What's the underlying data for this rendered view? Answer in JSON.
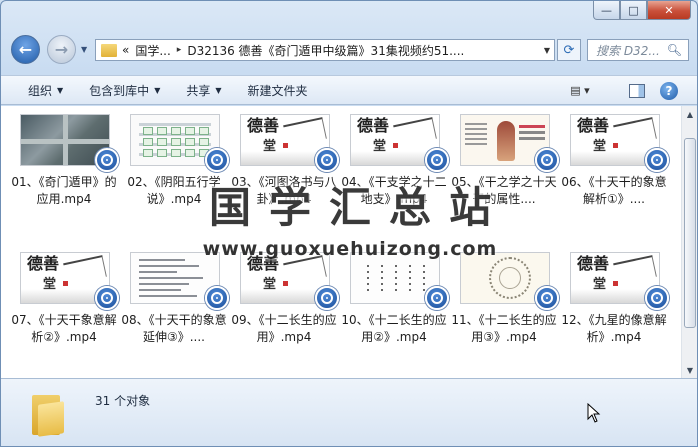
{
  "window": {
    "minimize_glyph": "—",
    "maximize_glyph": "□",
    "close_glyph": "✕"
  },
  "nav": {
    "back_glyph": "←",
    "forward_glyph": "→",
    "dropdown_glyph": "▼"
  },
  "address": {
    "prefix": "«",
    "segments": [
      "国学...",
      "D32136 德善《奇门遁甲中级篇》31集视频约51...."
    ],
    "separator": "▸",
    "dropdown_glyph": "▼",
    "refresh_glyph": "⟳"
  },
  "search": {
    "placeholder": "搜索 D32...",
    "icon": "search-icon"
  },
  "toolbar": {
    "organize": "组织",
    "include_in_library": "包含到库中",
    "share": "共享",
    "new_folder": "新建文件夹",
    "arrow": "▼",
    "view_glyph": "▤ ▾",
    "help_glyph": "?"
  },
  "files": [
    {
      "label": "01、《奇门遁甲》的应用.mp4",
      "thumb": "aerial"
    },
    {
      "label": "02、《阴阳五行学说》.mp4",
      "thumb": "table"
    },
    {
      "label": "03、《河图洛书与八卦》.mp4",
      "thumb": "ink"
    },
    {
      "label": "04、《干支学之十二地支》.mp4",
      "thumb": "ink"
    },
    {
      "label": "05、《干之学之十天干的属性....",
      "thumb": "sage"
    },
    {
      "label": "06、《十天干的象意解析①》....",
      "thumb": "ink"
    },
    {
      "label": "07、《十天干象意解析②》.mp4",
      "thumb": "ink"
    },
    {
      "label": "08、《十天干的象意延伸③》....",
      "thumb": "lines"
    },
    {
      "label": "09、《十二长生的应用》.mp4",
      "thumb": "ink"
    },
    {
      "label": "10、《十二长生的应用②》.mp4",
      "thumb": "dots"
    },
    {
      "label": "11、《十二长生的应用③》.mp4",
      "thumb": "circle"
    },
    {
      "label": "12、《九星的像意解析》.mp4",
      "thumb": "ink"
    }
  ],
  "thumb_text": {
    "callig_top": "德善",
    "callig_bottom": "堂"
  },
  "watermark": {
    "chinese": "国学汇总站",
    "url": "www.guoxuehuizong.com"
  },
  "scrollbar": {
    "up_glyph": "▲",
    "down_glyph": "▼"
  },
  "details": {
    "count_text": "31 个对象"
  }
}
